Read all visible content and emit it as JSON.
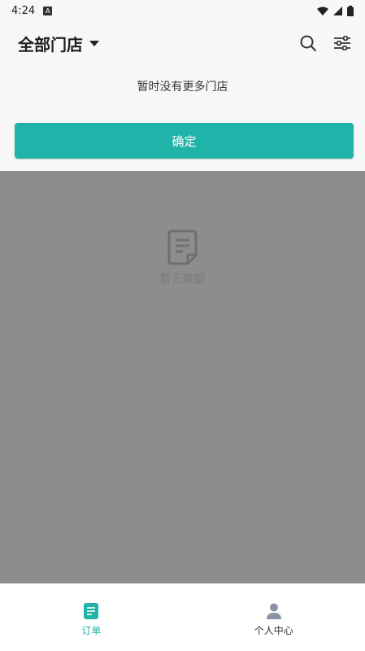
{
  "status_bar": {
    "time": "4:24",
    "badge": "A"
  },
  "header": {
    "title": "全部门店"
  },
  "notice": "暂时没有更多门店",
  "confirm_button": "确定",
  "empty_state": {
    "text": "暂无数据"
  },
  "tabbar": {
    "items": [
      {
        "label": "订单",
        "icon": "order-icon",
        "active": true
      },
      {
        "label": "个人中心",
        "icon": "person-icon",
        "active": false
      }
    ]
  },
  "colors": {
    "accent": "#1fb3aa",
    "overlay": "#8d8d8d"
  }
}
